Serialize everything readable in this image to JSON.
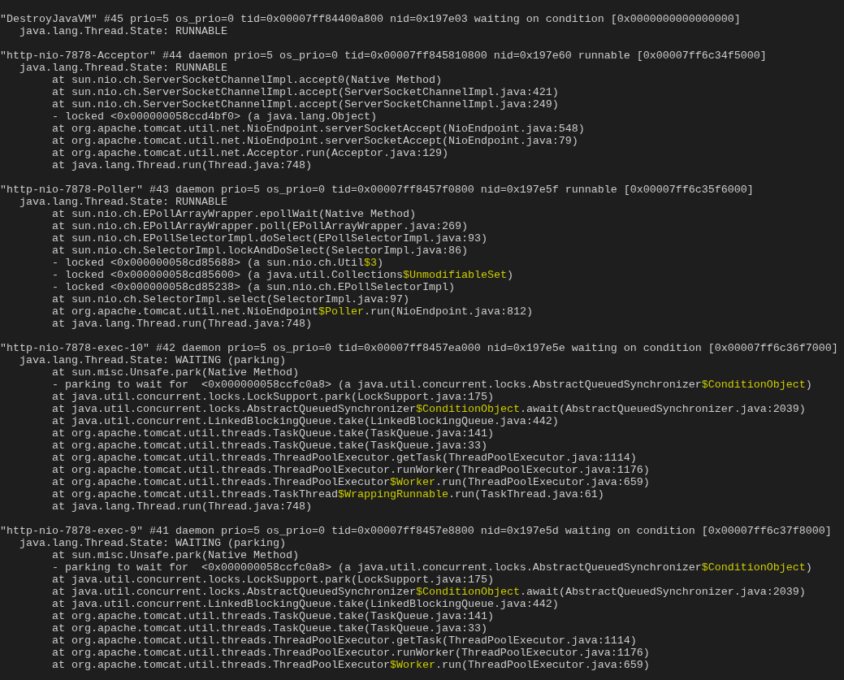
{
  "threads": [
    {
      "header": {
        "text": "\"DestroyJavaVM\" #45 prio=5 os_prio=0 tid=0x00007ff84400a800 nid=0x197e03 waiting on condition [0x0000000000000000]"
      },
      "state": {
        "text": "java.lang.Thread.State: RUNNABLE"
      }
    },
    {
      "header": {
        "text": "\"http-nio-7878-Acceptor\" #44 daemon prio=5 os_prio=0 tid=0x00007ff845810800 nid=0x197e60 runnable [0x00007ff6c34f5000]"
      },
      "state": {
        "text": "java.lang.Thread.State: RUNNABLE"
      },
      "frames": [
        {
          "text": "at sun.nio.ch.ServerSocketChannelImpl.accept0(Native Method)"
        },
        {
          "text": "at sun.nio.ch.ServerSocketChannelImpl.accept(ServerSocketChannelImpl.java:421)"
        },
        {
          "text": "at sun.nio.ch.ServerSocketChannelImpl.accept(ServerSocketChannelImpl.java:249)"
        },
        {
          "text": "- locked <0x000000058ccd4bf0> (a java.lang.Object)"
        },
        {
          "text": "at org.apache.tomcat.util.net.NioEndpoint.serverSocketAccept(NioEndpoint.java:548)"
        },
        {
          "text": "at org.apache.tomcat.util.net.NioEndpoint.serverSocketAccept(NioEndpoint.java:79)"
        },
        {
          "text": "at org.apache.tomcat.util.net.Acceptor.run(Acceptor.java:129)"
        },
        {
          "text": "at java.lang.Thread.run(Thread.java:748)"
        }
      ]
    },
    {
      "header": {
        "text": "\"http-nio-7878-Poller\" #43 daemon prio=5 os_prio=0 tid=0x00007ff8457f0800 nid=0x197e5f runnable [0x00007ff6c35f6000]"
      },
      "state": {
        "text": "java.lang.Thread.State: RUNNABLE"
      },
      "frames": [
        {
          "text": "at sun.nio.ch.EPollArrayWrapper.epollWait(Native Method)"
        },
        {
          "text": "at sun.nio.ch.EPollArrayWrapper.poll(EPollArrayWrapper.java:269)"
        },
        {
          "text": "at sun.nio.ch.EPollSelectorImpl.doSelect(EPollSelectorImpl.java:93)"
        },
        {
          "text": "at sun.nio.ch.SelectorImpl.lockAndDoSelect(SelectorImpl.java:86)"
        },
        {
          "text": "- locked <0x000000058cd85688> (a sun.nio.ch.Util",
          "inner": "$3",
          "after": ")"
        },
        {
          "text": "- locked <0x000000058cd85600> (a java.util.Collections",
          "inner": "$UnmodifiableSet",
          "after": ")"
        },
        {
          "text": "- locked <0x000000058cd85238> (a sun.nio.ch.EPollSelectorImpl)"
        },
        {
          "text": "at sun.nio.ch.SelectorImpl.select(SelectorImpl.java:97)"
        },
        {
          "text": "at org.apache.tomcat.util.net.NioEndpoint",
          "inner": "$Poller",
          "after": ".run(NioEndpoint.java:812)"
        },
        {
          "text": "at java.lang.Thread.run(Thread.java:748)"
        }
      ]
    },
    {
      "header": {
        "text": "\"http-nio-7878-exec-10\" #42 daemon prio=5 os_prio=0 tid=0x00007ff8457ea000 nid=0x197e5e waiting on condition [0x00007ff6c36f7000]"
      },
      "state": {
        "text": "java.lang.Thread.State: WAITING (parking)"
      },
      "frames": [
        {
          "text": "at sun.misc.Unsafe.park(Native Method)"
        },
        {
          "text": "- parking to wait for  <0x000000058ccfc0a8> (a java.util.concurrent.locks.AbstractQueuedSynchronizer",
          "inner": "$ConditionObject",
          "after": ")"
        },
        {
          "text": "at java.util.concurrent.locks.LockSupport.park(LockSupport.java:175)"
        },
        {
          "text": "at java.util.concurrent.locks.AbstractQueuedSynchronizer",
          "inner": "$ConditionObject",
          "after": ".await(AbstractQueuedSynchronizer.java:2039)"
        },
        {
          "text": "at java.util.concurrent.LinkedBlockingQueue.take(LinkedBlockingQueue.java:442)"
        },
        {
          "text": "at org.apache.tomcat.util.threads.TaskQueue.take(TaskQueue.java:141)"
        },
        {
          "text": "at org.apache.tomcat.util.threads.TaskQueue.take(TaskQueue.java:33)"
        },
        {
          "text": "at org.apache.tomcat.util.threads.ThreadPoolExecutor.getTask(ThreadPoolExecutor.java:1114)"
        },
        {
          "text": "at org.apache.tomcat.util.threads.ThreadPoolExecutor.runWorker(ThreadPoolExecutor.java:1176)"
        },
        {
          "text": "at org.apache.tomcat.util.threads.ThreadPoolExecutor",
          "inner": "$Worker",
          "after": ".run(ThreadPoolExecutor.java:659)"
        },
        {
          "text": "at org.apache.tomcat.util.threads.TaskThread",
          "inner": "$WrappingRunnable",
          "after": ".run(TaskThread.java:61)"
        },
        {
          "text": "at java.lang.Thread.run(Thread.java:748)"
        }
      ]
    },
    {
      "header": {
        "text": "\"http-nio-7878-exec-9\" #41 daemon prio=5 os_prio=0 tid=0x00007ff8457e8800 nid=0x197e5d waiting on condition [0x00007ff6c37f8000]"
      },
      "state": {
        "text": "java.lang.Thread.State: WAITING (parking)"
      },
      "frames": [
        {
          "text": "at sun.misc.Unsafe.park(Native Method)"
        },
        {
          "text": "- parking to wait for  <0x000000058ccfc0a8> (a java.util.concurrent.locks.AbstractQueuedSynchronizer",
          "inner": "$ConditionObject",
          "after": ")"
        },
        {
          "text": "at java.util.concurrent.locks.LockSupport.park(LockSupport.java:175)"
        },
        {
          "text": "at java.util.concurrent.locks.AbstractQueuedSynchronizer",
          "inner": "$ConditionObject",
          "after": ".await(AbstractQueuedSynchronizer.java:2039)"
        },
        {
          "text": "at java.util.concurrent.LinkedBlockingQueue.take(LinkedBlockingQueue.java:442)"
        },
        {
          "text": "at org.apache.tomcat.util.threads.TaskQueue.take(TaskQueue.java:141)"
        },
        {
          "text": "at org.apache.tomcat.util.threads.TaskQueue.take(TaskQueue.java:33)"
        },
        {
          "text": "at org.apache.tomcat.util.threads.ThreadPoolExecutor.getTask(ThreadPoolExecutor.java:1114)"
        },
        {
          "text": "at org.apache.tomcat.util.threads.ThreadPoolExecutor.runWorker(ThreadPoolExecutor.java:1176)"
        },
        {
          "text": "at org.apache.tomcat.util.threads.ThreadPoolExecutor",
          "inner": "$Worker",
          "after": ".run(ThreadPoolExecutor.java:659)"
        }
      ]
    }
  ]
}
